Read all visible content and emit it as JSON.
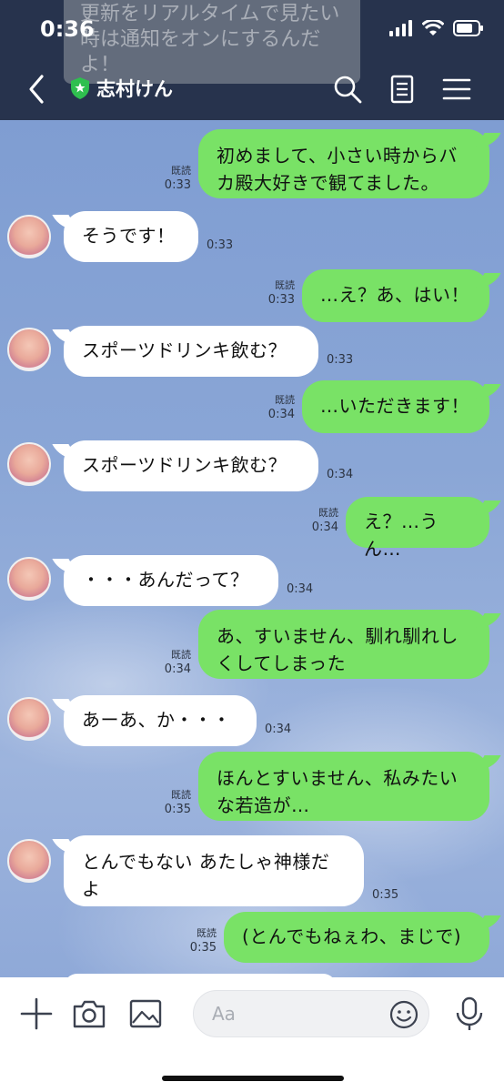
{
  "status": {
    "time": "0:36"
  },
  "notification": {
    "text": "更新をリアルタイムで見たい時は通知をオンにするんだよ！"
  },
  "header": {
    "title": "志村けん"
  },
  "messages": [
    {
      "side": "out",
      "lines": [
        "初めまして、小さい時からバ",
        "カ殿大好きで観てました。"
      ],
      "read": "既読",
      "time": "0:33"
    },
    {
      "side": "in",
      "lines": [
        "そうです！"
      ],
      "time": "0:33"
    },
    {
      "side": "out",
      "lines": [
        "…え？あ、はい！"
      ],
      "read": "既読",
      "time": "0:33"
    },
    {
      "side": "in",
      "lines": [
        "スポーツドリンキ飲む？"
      ],
      "time": "0:33"
    },
    {
      "side": "out",
      "lines": [
        "…いただきます！"
      ],
      "read": "既読",
      "time": "0:34"
    },
    {
      "side": "in",
      "lines": [
        "スポーツドリンキ飲む？"
      ],
      "time": "0:34"
    },
    {
      "side": "out",
      "lines": [
        "え？…うん…"
      ],
      "read": "既読",
      "time": "0:34"
    },
    {
      "side": "in",
      "lines": [
        "・・・あんだって？"
      ],
      "time": "0:34"
    },
    {
      "side": "out",
      "lines": [
        "あ、すいません、馴れ馴れし",
        "くしてしまった"
      ],
      "read": "既読",
      "time": "0:34"
    },
    {
      "side": "in",
      "lines": [
        "あーあ、か・・・"
      ],
      "time": "0:34"
    },
    {
      "side": "out",
      "lines": [
        "ほんとすいません、私みたい",
        "な若造が…"
      ],
      "read": "既読",
      "time": "0:35"
    },
    {
      "side": "in",
      "lines": [
        "とんでもない あたしゃ神様だ",
        "よ"
      ],
      "time": "0:35"
    },
    {
      "side": "out",
      "lines": [
        "(とんでもねぇわ、まじで)"
      ],
      "read": "既読",
      "time": "0:35"
    }
  ],
  "input": {
    "placeholder": "Aa"
  },
  "icons": {
    "back": "back-chevron-icon",
    "verified": "verified-shield-icon",
    "search": "search-icon",
    "notes": "notes-icon",
    "menu": "menu-icon",
    "plus": "plus-icon",
    "camera": "camera-icon",
    "image": "image-icon",
    "emoji": "emoji-icon",
    "mic": "mic-icon"
  },
  "colors": {
    "header_bg": "#27334d",
    "out_bubble": "#79e266",
    "in_bubble": "#ffffff",
    "chat_bg": "#8aa6d6",
    "verified": "#2fbf4f"
  }
}
